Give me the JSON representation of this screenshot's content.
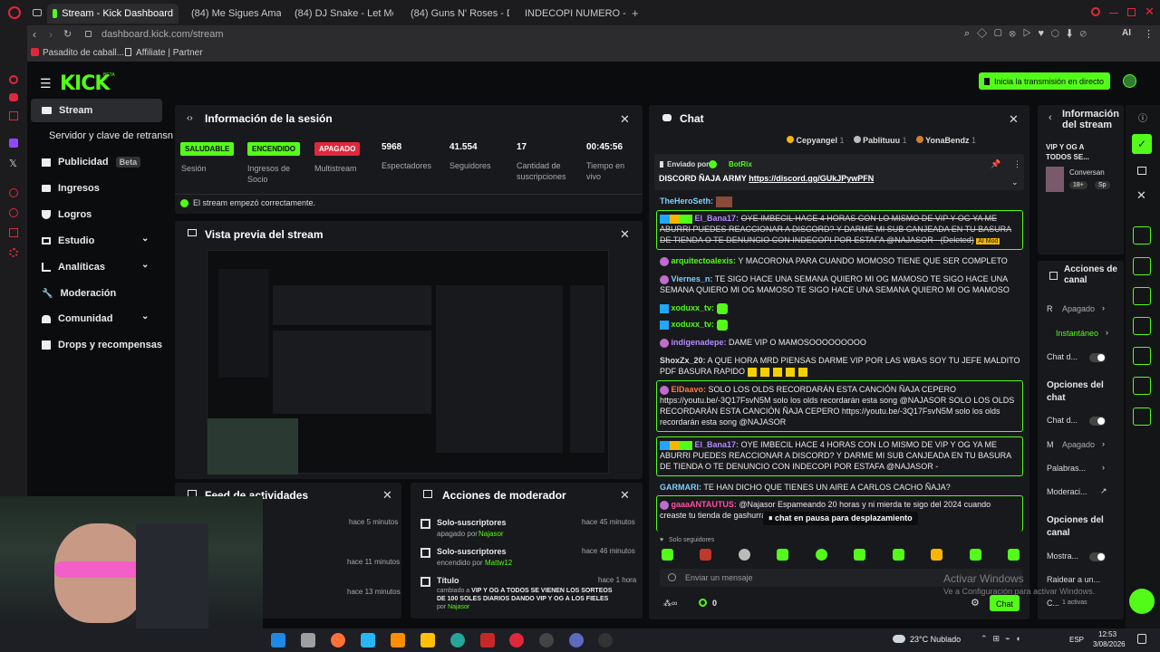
{
  "browser": {
    "tabs": [
      {
        "label": "Stream - Kick Dashboard",
        "active": true
      },
      {
        "label": "(84) Me Sigues Amand"
      },
      {
        "label": "(84) DJ Snake - Let Me"
      },
      {
        "label": "(84) Guns N' Roses - D"
      },
      {
        "label": "INDECOPI NUMERO - Busc"
      }
    ],
    "url": "dashboard.kick.com/stream",
    "bookmarks": [
      "Pasadito de caball...",
      "Affiliate | Partner"
    ]
  },
  "header": {
    "logo": "KICK",
    "logo_beta": "BETA",
    "go_live_label": "Inicia la transmisión en directo"
  },
  "sidebar": {
    "items": [
      {
        "label": "Stream",
        "active": true
      },
      {
        "label": "Servidor y clave de retransn"
      },
      {
        "label": "Publicidad",
        "badge": "Beta"
      },
      {
        "label": "Ingresos"
      },
      {
        "label": "Logros"
      },
      {
        "label": "Estudio"
      },
      {
        "label": "Analíticas"
      },
      {
        "label": "Moderación"
      },
      {
        "label": "Comunidad"
      },
      {
        "label": "Drops y recompensas"
      }
    ]
  },
  "session": {
    "title": "Información de la sesión",
    "badges": [
      {
        "badge": "SALUDABLE",
        "label": "Sesión"
      },
      {
        "badge": "ENCENDIDO",
        "label": "Ingresos de Socio"
      },
      {
        "badge": "APAGADO",
        "label": "Multistream"
      }
    ],
    "stats": [
      {
        "value": "5968",
        "label": "Espectadores"
      },
      {
        "value": "41.554",
        "label": "Seguidores"
      },
      {
        "value": "17",
        "label": "Cantidad de suscripciones"
      },
      {
        "value": "00:45:56",
        "label": "Tiempo en vivo"
      }
    ],
    "status": "El stream empezó correctamente."
  },
  "preview": {
    "title": "Vista previa del stream"
  },
  "activity": {
    "title": "Feed de actividades",
    "times": [
      "hace 5 minutos",
      "hace 11 minutos",
      "hace 13 minutos"
    ]
  },
  "modactions": {
    "title": "Acciones de moderador",
    "items": [
      {
        "title": "Solo-suscriptores",
        "sub": "apagado por",
        "user": "Najasor",
        "time": "hace 45 minutos"
      },
      {
        "title": "Solo-suscriptores",
        "sub": "encendido por",
        "user": "Mattw12",
        "time": "hace 46 minutos"
      },
      {
        "title": "Título",
        "sub": "cambiado a",
        "text": "VIP Y OG A TODOS SE VIENEN LOS SORTEOS DE 100 SOLES DIARIOS DANDO VIP Y OG A LOS FIELES",
        "by": "por",
        "user": "Najasor",
        "time": "hace 1 hora"
      }
    ]
  },
  "chat": {
    "title": "Chat",
    "top_gifters": [
      {
        "name": "Cepyangel",
        "count": "1"
      },
      {
        "name": "Pablituuu",
        "count": "1"
      },
      {
        "name": "YonaBendz",
        "count": "1"
      }
    ],
    "pinned": {
      "prefix": "Enviado por",
      "user": "BotRix",
      "text": "DISCORD ÑAJA ARMY",
      "link": "https://discord.gg/GUkJPywPFN"
    },
    "messages": [
      {
        "user": "TheHeroSeth:",
        "text": ""
      },
      {
        "user": "El_Bana17:",
        "text": "OYE IMBECIL HACE 4 HORAS CON LO MISMO DE VIP Y OG YA ME ABURRI PUEDES REACCIONAR A DISCORD? Y DARME MI SUB CANJEADA EN TU BASURA DE TIENDA O TE DENUNCIO CON INDECOPI POR ESTAFA @NAJASOR - (Deleted)",
        "tag": "AI Mod"
      },
      {
        "user": "arquitectoalexis:",
        "text": "Y MACORONA PARA CUANDO MOMOSO TIENE QUE SER COMPLETO"
      },
      {
        "user": "Viernes_n:",
        "text": "TE SIGO HACE UNA SEMANA QUIERO MI OG MAMOSO TE SIGO HACE UNA SEMANA QUIERO MI OG MAMOSO TE SIGO HACE UNA SEMANA QUIERO MI OG MAMOSO"
      },
      {
        "user": "xoduxx_tv:",
        "text": ""
      },
      {
        "user": "xoduxx_tv:",
        "text": ""
      },
      {
        "user": "indigenadepe:",
        "text": "DAME VIP O MAMOSOOOOOOOOO"
      },
      {
        "user": "ShoxZx_20:",
        "text": "A QUE HORA MRD PIENSAS DARME VIP POR LAS WBAS SOY TU JEFE MALDITO PDF BASURA RAPIDO"
      },
      {
        "user": "ElDaavo:",
        "text": "SOLO LOS OLDS RECORDARÁN ESTA CANCIÓN ÑAJA CEPERO https://youtu.be/-3Q17FsvN5M solo los olds recordarán esta song @NAJASOR SOLO LOS OLDS RECORDARÁN ESTA CANCIÓN ÑAJA CEPERO https://youtu.be/-3Q17FsvN5M solo los olds recordarán esta song @NAJASOR"
      },
      {
        "user": "El_Bana17:",
        "text": "OYE IMBECIL HACE 4 HORAS CON LO MISMO DE VIP Y OG YA ME ABURRI PUEDES REACCIONAR A DISCORD? Y DARME MI SUB CANJEADA EN TU BASURA DE TIENDA O TE DENUNCIO CON INDECOPI POR ESTAFA @NAJASOR -"
      },
      {
        "user": "GARMARI:",
        "text": "TE HAN DICHO QUE TIENES UN AIRE A CARLOS CACHO ÑAJA?"
      },
      {
        "user": "gaaaANTAUTUS:",
        "text": "@Najasor Espameando 20 horas y ni mierda te sigo del 2024 cuando creaste tu tienda de gashurras"
      }
    ],
    "paused_label": "chat en pausa para desplazamiento",
    "followers_only": "Solo seguidores",
    "input_placeholder": "Enviar un mensaje",
    "send_label": "Chat",
    "points": "0"
  },
  "right_panel": {
    "stream_info_title": "Información del stream",
    "stream_title": "VIP Y OG A TODOS SE...",
    "category": "Conversan",
    "tags": [
      "18+",
      "Sp"
    ],
    "channel_actions_title": "Acciones de canal",
    "r_label": "R",
    "r_value": "Apagado",
    "instant_label": "Instantáneo",
    "chat_d1": "Chat d...",
    "chat_options_title": "Opciones del chat",
    "chat_d2": "Chat d...",
    "m_label": "M",
    "m_value": "Apagado",
    "words": "Palabras...",
    "moderation": "Moderaci...",
    "channel_options_title": "Opciones del canal",
    "show": "Mostra...",
    "raid": "Raidear a un...",
    "c_label": "C...",
    "c_value": "1 activas"
  },
  "overlay": {
    "activate_title": "Activar Windows",
    "activate_sub": "Ve a Configuración para activar Windows."
  },
  "taskbar": {
    "weather": "23°C  Nublado",
    "lang": "ESP",
    "time": "12:53",
    "date": "3/08/2026"
  }
}
